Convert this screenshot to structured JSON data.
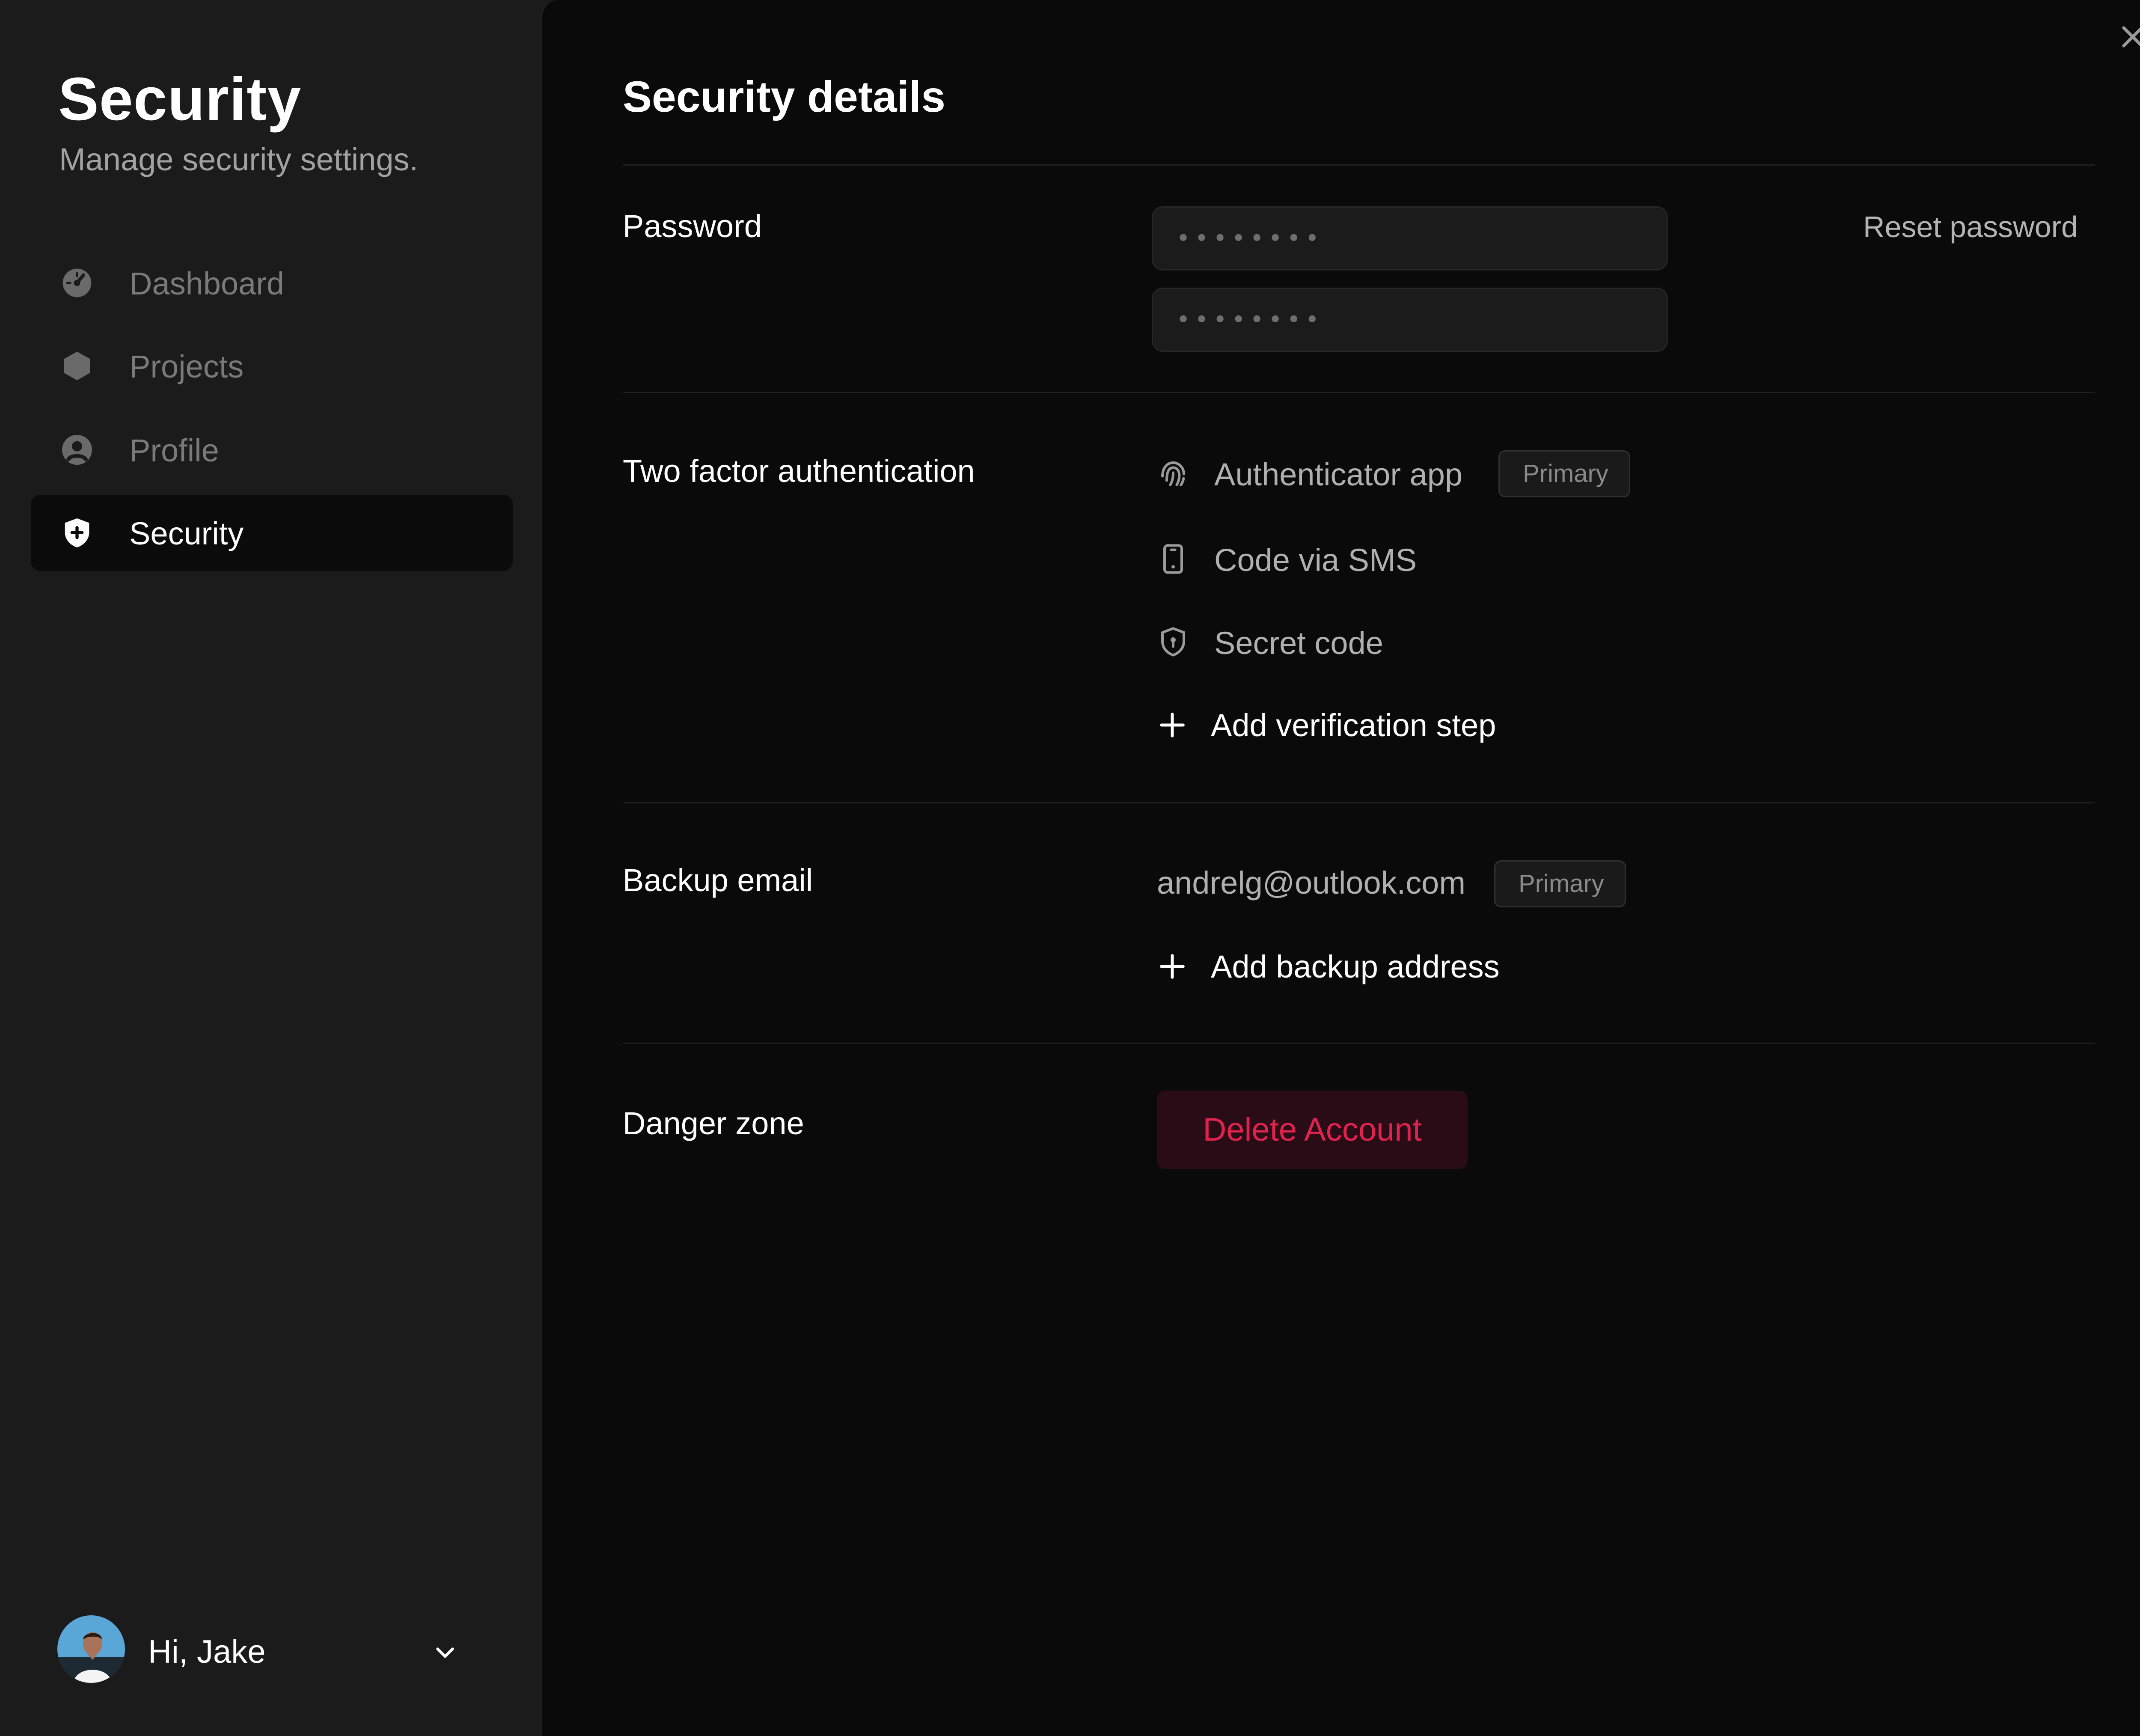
{
  "sidebar": {
    "title": "Security",
    "subtitle": "Manage security settings.",
    "nav": [
      {
        "label": "Dashboard",
        "icon": "dashboard-gauge-icon"
      },
      {
        "label": "Projects",
        "icon": "hexagon-icon"
      },
      {
        "label": "Profile",
        "icon": "user-circle-icon"
      },
      {
        "label": "Security",
        "icon": "shield-plus-icon",
        "active": true
      }
    ],
    "user": {
      "greeting": "Hi, Jake",
      "icon": "chevron-down-icon"
    }
  },
  "main": {
    "title": "Security details",
    "close_icon": "close-icon",
    "password": {
      "label": "Password",
      "field1": "••••••••",
      "field2": "••••••••",
      "reset_label": "Reset password"
    },
    "two_factor": {
      "label": "Two factor authentication",
      "methods": [
        {
          "label": "Authenticator app",
          "icon": "fingerprint-icon",
          "badge": "Primary"
        },
        {
          "label": "Code via SMS",
          "icon": "smartphone-icon"
        },
        {
          "label": "Secret code",
          "icon": "shield-lock-icon"
        }
      ],
      "add_label": "Add verification step"
    },
    "backup_email": {
      "label": "Backup email",
      "value": "andrelg@outlook.com",
      "badge": "Primary",
      "add_label": "Add backup address"
    },
    "danger": {
      "label": "Danger zone",
      "button_label": "Delete Account"
    }
  },
  "colors": {
    "sidebar_bg": "#1b1b1b",
    "main_bg": "#0a0a0a",
    "danger_text": "#e0234e",
    "danger_bg": "#2a0c16"
  }
}
